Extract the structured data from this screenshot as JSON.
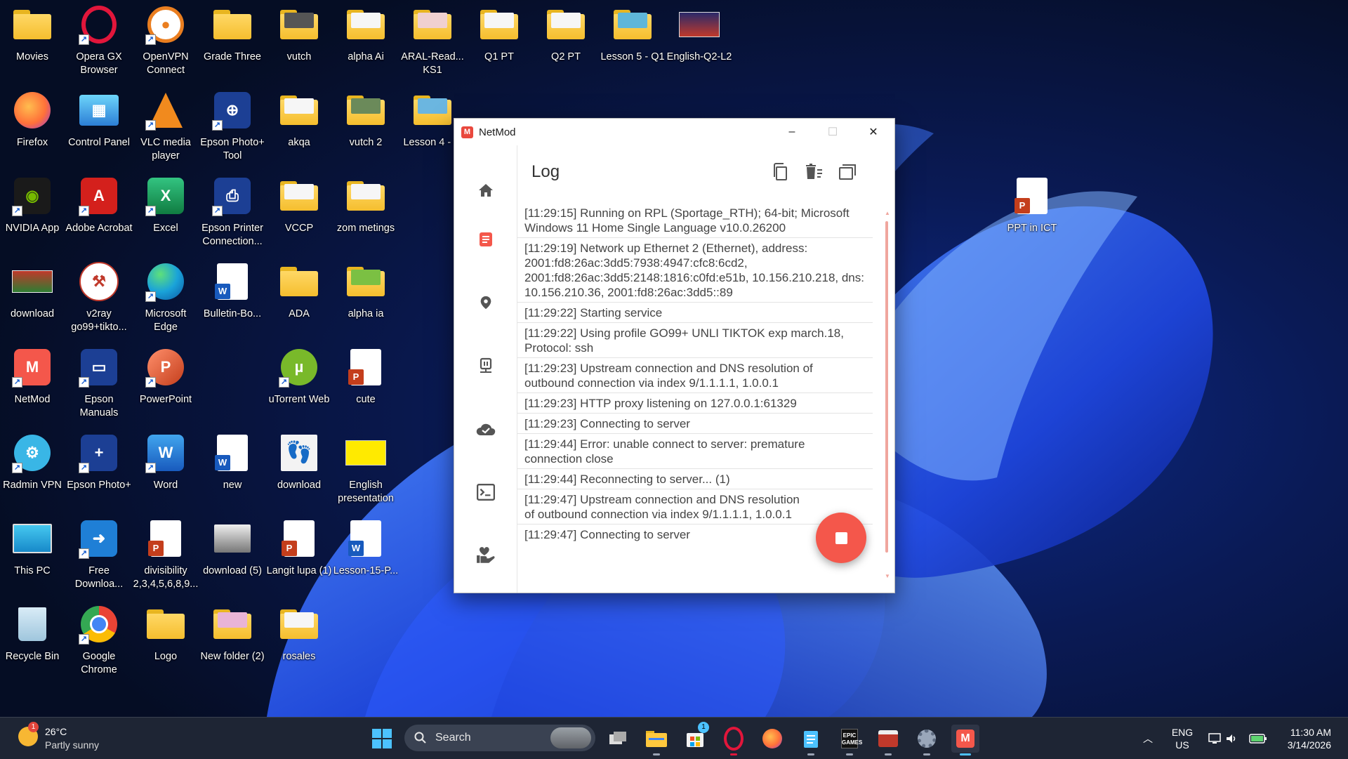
{
  "desktop": {
    "icons": [
      {
        "label": "Movies"
      },
      {
        "label": "Opera GX Browser"
      },
      {
        "label": "OpenVPN Connect"
      },
      {
        "label": "Grade Three"
      },
      {
        "label": "vutch"
      },
      {
        "label": "alpha Ai"
      },
      {
        "label": "ARAL-Read... KS1"
      },
      {
        "label": "Q1 PT"
      },
      {
        "label": "Q2 PT"
      },
      {
        "label": "Lesson 5 - Q1"
      },
      {
        "label": "English-Q2-L2"
      },
      {
        "label": "Firefox"
      },
      {
        "label": "Control Panel"
      },
      {
        "label": "VLC media player"
      },
      {
        "label": "Epson Photo+ Tool"
      },
      {
        "label": "akqa"
      },
      {
        "label": "vutch 2"
      },
      {
        "label": "Lesson 4 - Q"
      },
      {
        "label": "NVIDIA App"
      },
      {
        "label": "Adobe Acrobat"
      },
      {
        "label": "Excel"
      },
      {
        "label": "Epson Printer Connection..."
      },
      {
        "label": "VCCP"
      },
      {
        "label": "zom metings"
      },
      {
        "label": "download"
      },
      {
        "label": "v2ray go99+tikto..."
      },
      {
        "label": "Microsoft Edge"
      },
      {
        "label": "Bulletin-Bo..."
      },
      {
        "label": "ADA"
      },
      {
        "label": "alpha ia"
      },
      {
        "label": "NetMod"
      },
      {
        "label": "Epson Manuals"
      },
      {
        "label": "PowerPoint"
      },
      {
        "label": "uTorrent Web"
      },
      {
        "label": "cute"
      },
      {
        "label": "Radmin VPN"
      },
      {
        "label": "Epson Photo+"
      },
      {
        "label": "Word"
      },
      {
        "label": "new"
      },
      {
        "label": "download"
      },
      {
        "label": "English presentation"
      },
      {
        "label": "This PC"
      },
      {
        "label": "Free Downloa..."
      },
      {
        "label": "divisibility 2,3,4,5,6,8,9..."
      },
      {
        "label": "download (5)"
      },
      {
        "label": "Langit lupa (1)"
      },
      {
        "label": "Lesson-15-P..."
      },
      {
        "label": "Recycle Bin"
      },
      {
        "label": "Google Chrome"
      },
      {
        "label": "Logo"
      },
      {
        "label": "New folder (2)"
      },
      {
        "label": "rosales"
      },
      {
        "label": "PPT in ICT"
      }
    ]
  },
  "window": {
    "title": "NetMod",
    "minimize": "–",
    "maximize": "☐",
    "close": "✕",
    "page_title": "Log",
    "log_entries": [
      "[11:29:15] Running on RPL (Sportage_RTH); 64-bit; Microsoft Windows 11 Home Single Language v10.0.26200",
      "[11:29:19] Network up Ethernet 2 (Ethernet), address: 2001:fd8:26ac:3dd5:7938:4947:cfc8:6cd2, 2001:fd8:26ac:3dd5:2148:1816:c0fd:e51b, 10.156.210.218, dns: 10.156.210.36, 2001:fd8:26ac:3dd5::89",
      "[11:29:22] Starting service",
      "[11:29:22] Using profile GO99+ UNLI TIKTOK exp march.18, Protocol: ssh",
      "[11:29:23] Upstream connection and DNS resolution of outbound connection via index 9/1.1.1.1, 1.0.0.1",
      "[11:29:23] HTTP proxy listening on 127.0.0.1:61329",
      "[11:29:23] Connecting to server",
      "[11:29:44] Error: unable connect to server: premature connection close",
      "[11:29:44] Reconnecting to server... (1)",
      "[11:29:47] Upstream connection and DNS resolution of outbound connection via index 9/1.1.1.1, 1.0.0.1",
      "[11:29:47] Connecting to server"
    ],
    "accent_color": "#f4574b"
  },
  "taskbar": {
    "weather": {
      "temp": "26°C",
      "condition": "Partly sunny",
      "badge": "1"
    },
    "search": {
      "placeholder": "Search"
    },
    "store_badge": "1",
    "language": {
      "line1": "ENG",
      "line2": "US"
    },
    "clock": {
      "time": "11:30 AM",
      "date": "3/14/2026"
    }
  }
}
